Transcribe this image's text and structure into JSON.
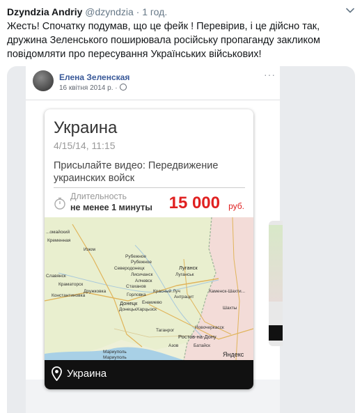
{
  "tweet": {
    "author": "Dzyndzia Andriy",
    "handle": "@dzyndzia",
    "separator": "·",
    "time": "1 год.",
    "text": "Жесть! Спочатку подумав, що це фейк ! Перевірив, і це дійсно так, дружина Зеленського поширювала російську пропаганду закликом повідомляти про пересування Українських військових!"
  },
  "fb_post": {
    "author": "Елена Зеленская",
    "date": "16 квітня 2014 р. ·",
    "more": "···"
  },
  "card": {
    "title": "Украина",
    "date": "4/15/14, 11:15",
    "description": "Присылайте видео: Передвижение украинских войск",
    "duration_label": "Длительность",
    "duration_value": "не менее 1 минуты",
    "price": "15 000",
    "currency": "руб.",
    "footer_location": "Украина"
  },
  "map": {
    "provider": "Яндекс",
    "cities": [
      "...омайский",
      "Кременная",
      "Изюм",
      "Рубежное",
      "Рубежное",
      "Северодонецк",
      "Славянск",
      "Лисичанск",
      "Луганск",
      "Луганськ",
      "Краматорск",
      "Дружковка",
      "Алчевск",
      "Стаханов",
      "Константиновка",
      "Горловка",
      "Донецк",
      "Донецьк",
      "Харцызск",
      "Енакиево",
      "Антрацит",
      "Каменск-Шахти...",
      "Красный Луч",
      "Шахты",
      "Новочеркасск",
      "Ростов-на-Дону",
      "Таганрог",
      "Мариуполь",
      "Мариуполь",
      "Азов",
      "Батайск"
    ]
  }
}
